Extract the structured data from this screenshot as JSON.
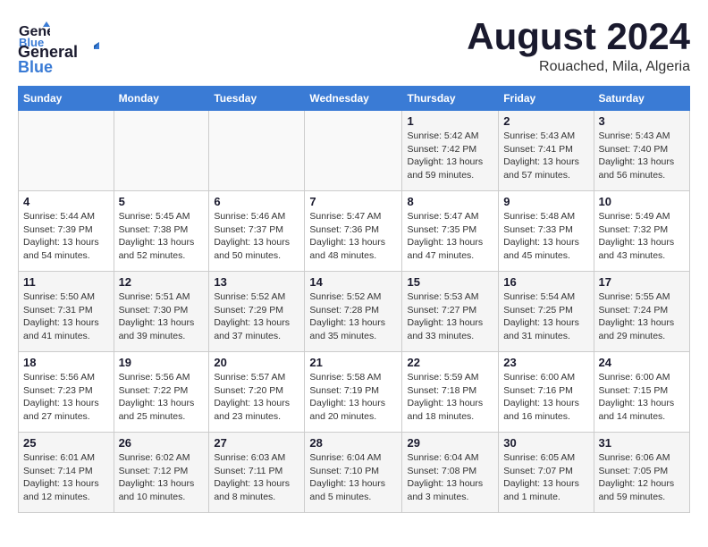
{
  "header": {
    "logo": {
      "line1": "General",
      "line2": "Blue"
    },
    "title": "August 2024",
    "location": "Rouached, Mila, Algeria"
  },
  "weekdays": [
    "Sunday",
    "Monday",
    "Tuesday",
    "Wednesday",
    "Thursday",
    "Friday",
    "Saturday"
  ],
  "weeks": [
    [
      {
        "day": "",
        "info": ""
      },
      {
        "day": "",
        "info": ""
      },
      {
        "day": "",
        "info": ""
      },
      {
        "day": "",
        "info": ""
      },
      {
        "day": "1",
        "info": "Sunrise: 5:42 AM\nSunset: 7:42 PM\nDaylight: 13 hours\nand 59 minutes."
      },
      {
        "day": "2",
        "info": "Sunrise: 5:43 AM\nSunset: 7:41 PM\nDaylight: 13 hours\nand 57 minutes."
      },
      {
        "day": "3",
        "info": "Sunrise: 5:43 AM\nSunset: 7:40 PM\nDaylight: 13 hours\nand 56 minutes."
      }
    ],
    [
      {
        "day": "4",
        "info": "Sunrise: 5:44 AM\nSunset: 7:39 PM\nDaylight: 13 hours\nand 54 minutes."
      },
      {
        "day": "5",
        "info": "Sunrise: 5:45 AM\nSunset: 7:38 PM\nDaylight: 13 hours\nand 52 minutes."
      },
      {
        "day": "6",
        "info": "Sunrise: 5:46 AM\nSunset: 7:37 PM\nDaylight: 13 hours\nand 50 minutes."
      },
      {
        "day": "7",
        "info": "Sunrise: 5:47 AM\nSunset: 7:36 PM\nDaylight: 13 hours\nand 48 minutes."
      },
      {
        "day": "8",
        "info": "Sunrise: 5:47 AM\nSunset: 7:35 PM\nDaylight: 13 hours\nand 47 minutes."
      },
      {
        "day": "9",
        "info": "Sunrise: 5:48 AM\nSunset: 7:33 PM\nDaylight: 13 hours\nand 45 minutes."
      },
      {
        "day": "10",
        "info": "Sunrise: 5:49 AM\nSunset: 7:32 PM\nDaylight: 13 hours\nand 43 minutes."
      }
    ],
    [
      {
        "day": "11",
        "info": "Sunrise: 5:50 AM\nSunset: 7:31 PM\nDaylight: 13 hours\nand 41 minutes."
      },
      {
        "day": "12",
        "info": "Sunrise: 5:51 AM\nSunset: 7:30 PM\nDaylight: 13 hours\nand 39 minutes."
      },
      {
        "day": "13",
        "info": "Sunrise: 5:52 AM\nSunset: 7:29 PM\nDaylight: 13 hours\nand 37 minutes."
      },
      {
        "day": "14",
        "info": "Sunrise: 5:52 AM\nSunset: 7:28 PM\nDaylight: 13 hours\nand 35 minutes."
      },
      {
        "day": "15",
        "info": "Sunrise: 5:53 AM\nSunset: 7:27 PM\nDaylight: 13 hours\nand 33 minutes."
      },
      {
        "day": "16",
        "info": "Sunrise: 5:54 AM\nSunset: 7:25 PM\nDaylight: 13 hours\nand 31 minutes."
      },
      {
        "day": "17",
        "info": "Sunrise: 5:55 AM\nSunset: 7:24 PM\nDaylight: 13 hours\nand 29 minutes."
      }
    ],
    [
      {
        "day": "18",
        "info": "Sunrise: 5:56 AM\nSunset: 7:23 PM\nDaylight: 13 hours\nand 27 minutes."
      },
      {
        "day": "19",
        "info": "Sunrise: 5:56 AM\nSunset: 7:22 PM\nDaylight: 13 hours\nand 25 minutes."
      },
      {
        "day": "20",
        "info": "Sunrise: 5:57 AM\nSunset: 7:20 PM\nDaylight: 13 hours\nand 23 minutes."
      },
      {
        "day": "21",
        "info": "Sunrise: 5:58 AM\nSunset: 7:19 PM\nDaylight: 13 hours\nand 20 minutes."
      },
      {
        "day": "22",
        "info": "Sunrise: 5:59 AM\nSunset: 7:18 PM\nDaylight: 13 hours\nand 18 minutes."
      },
      {
        "day": "23",
        "info": "Sunrise: 6:00 AM\nSunset: 7:16 PM\nDaylight: 13 hours\nand 16 minutes."
      },
      {
        "day": "24",
        "info": "Sunrise: 6:00 AM\nSunset: 7:15 PM\nDaylight: 13 hours\nand 14 minutes."
      }
    ],
    [
      {
        "day": "25",
        "info": "Sunrise: 6:01 AM\nSunset: 7:14 PM\nDaylight: 13 hours\nand 12 minutes."
      },
      {
        "day": "26",
        "info": "Sunrise: 6:02 AM\nSunset: 7:12 PM\nDaylight: 13 hours\nand 10 minutes."
      },
      {
        "day": "27",
        "info": "Sunrise: 6:03 AM\nSunset: 7:11 PM\nDaylight: 13 hours\nand 8 minutes."
      },
      {
        "day": "28",
        "info": "Sunrise: 6:04 AM\nSunset: 7:10 PM\nDaylight: 13 hours\nand 5 minutes."
      },
      {
        "day": "29",
        "info": "Sunrise: 6:04 AM\nSunset: 7:08 PM\nDaylight: 13 hours\nand 3 minutes."
      },
      {
        "day": "30",
        "info": "Sunrise: 6:05 AM\nSunset: 7:07 PM\nDaylight: 13 hours\nand 1 minute."
      },
      {
        "day": "31",
        "info": "Sunrise: 6:06 AM\nSunset: 7:05 PM\nDaylight: 12 hours\nand 59 minutes."
      }
    ]
  ]
}
